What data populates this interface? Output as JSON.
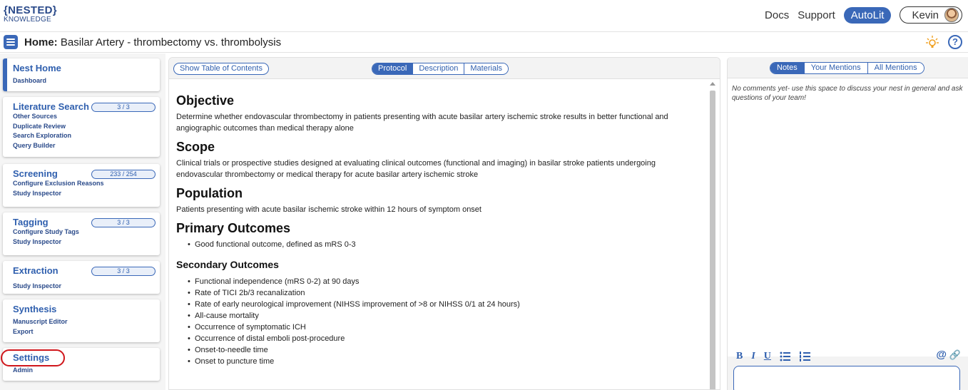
{
  "header": {
    "logo_line1": "{NESTED}",
    "logo_line2": "KNOWLEDGE",
    "docs": "Docs",
    "support": "Support",
    "autolit": "AutoLit",
    "user": "Kevin"
  },
  "titlebar": {
    "home_label": "Home:",
    "project": "Basilar Artery - thrombectomy vs. thrombolysis"
  },
  "sidebar": {
    "nest_home": {
      "title": "Nest Home",
      "links": [
        "Dashboard"
      ]
    },
    "literature_search": {
      "title": "Literature Search",
      "count": "3 / 3",
      "links": [
        "Other Sources",
        "Duplicate Review",
        "Search Exploration",
        "Query Builder"
      ]
    },
    "screening": {
      "title": "Screening",
      "count": "233 / 254",
      "links": [
        "Configure Exclusion Reasons",
        "Study Inspector"
      ]
    },
    "tagging": {
      "title": "Tagging",
      "count": "3 / 3",
      "links": [
        "Configure Study Tags",
        "Study Inspector"
      ]
    },
    "extraction": {
      "title": "Extraction",
      "count": "3 / 3",
      "links": [
        "Study Inspector"
      ]
    },
    "synthesis": {
      "title": "Synthesis",
      "links": [
        "Manuscript Editor",
        "Export"
      ]
    },
    "settings": {
      "title": "Settings",
      "links": [
        "Admin"
      ]
    }
  },
  "main": {
    "toc_button": "Show Table of Contents",
    "tabs": [
      "Protocol",
      "Description",
      "Materials"
    ],
    "active_tab": "Protocol",
    "objective_heading": "Objective",
    "objective_text": "Determine whether endovascular thrombectomy in patients presenting with acute basilar artery ischemic stroke results in better functional and angiographic outcomes than medical therapy alone",
    "scope_heading": "Scope",
    "scope_text": "Clinical trials or prospective studies designed at evaluating clinical outcomes (functional and imaging) in basilar stroke patients undergoing endovascular thrombectomy or medical therapy for acute basilar artery ischemic stroke",
    "population_heading": "Population",
    "population_text": "Patients presenting with acute basilar ischemic stroke within 12 hours of symptom onset",
    "primary_heading": "Primary Outcomes",
    "primary_items": [
      "Good functional outcome, defined as mRS 0-3"
    ],
    "secondary_heading": "Secondary Outcomes",
    "secondary_items": [
      "Functional independence (mRS 0-2) at 90 days",
      "Rate of TICI 2b/3 recanalization",
      "Rate of early neurological improvement (NIHSS improvement of >8 or NIHSS 0/1 at 24 hours)",
      "All-cause mortality",
      "Occurrence of symptomatic ICH",
      "Occurrence of distal emboli post-procedure",
      "Onset-to-needle time",
      "Onset to puncture time"
    ]
  },
  "notes": {
    "tabs": [
      "Notes",
      "Your Mentions",
      "All Mentions"
    ],
    "active_tab": "Notes",
    "empty_text": "No comments yet- use this space to discuss your nest in general and ask questions of your team!",
    "toolbar": [
      "B",
      "I",
      "U"
    ]
  },
  "colors": {
    "brand": "#3a68b8",
    "highlight": "#d0161b",
    "panel_bg": "#f3f3f3"
  },
  "icons": [
    "menu-icon",
    "lightbulb-icon",
    "help-icon",
    "bulleted-list-icon",
    "numbered-list-icon",
    "mention-icon",
    "link-icon"
  ]
}
